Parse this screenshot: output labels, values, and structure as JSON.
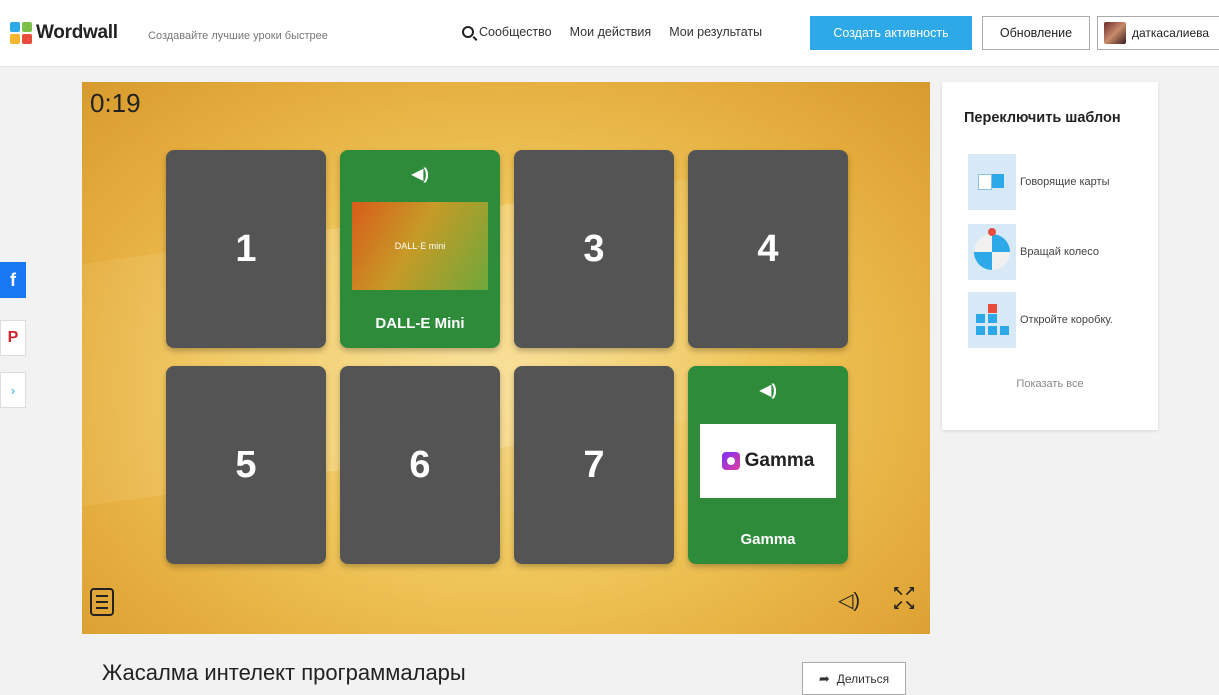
{
  "header": {
    "logo_text": "Wordwall",
    "tagline": "Создавайте лучшие уроки быстрее",
    "nav": {
      "community": "Сообщество",
      "my_activities": "Мои действия",
      "my_results": "Мои результаты"
    },
    "create_button": "Создать активность",
    "update_button": "Обновление",
    "username": "даткасалиева"
  },
  "share_bar": {
    "facebook": "f",
    "pinterest": "P",
    "other": "›"
  },
  "game": {
    "timer": "0:19",
    "tiles": [
      {
        "label": "1",
        "open": false
      },
      {
        "label": "",
        "open": true,
        "image_text": "DALL·E mini",
        "caption": "DALL-E Mini"
      },
      {
        "label": "3",
        "open": false
      },
      {
        "label": "4",
        "open": false
      },
      {
        "label": "5",
        "open": false
      },
      {
        "label": "6",
        "open": false
      },
      {
        "label": "7",
        "open": false
      },
      {
        "label": "",
        "open": true,
        "image_text": "Gamma",
        "caption": "Gamma"
      }
    ],
    "speaker_glyph": "◀)",
    "sound_glyph": "◁)",
    "fullscreen_top": "↖↗",
    "fullscreen_bottom": "↙↘"
  },
  "side_panel": {
    "title": "Переключить шаблон",
    "templates": [
      {
        "label": "Говорящие карты"
      },
      {
        "label": "Вращай колесо"
      },
      {
        "label": "Откройте коробку."
      }
    ],
    "show_all": "Показать все"
  },
  "activity": {
    "title": "Жасалма интелект программалары",
    "share_button": "Делиться"
  },
  "colors": {
    "accent": "#2ea9e8",
    "tile_closed": "#545454",
    "tile_open": "#2e8b3a",
    "game_bg": "#efc558"
  }
}
